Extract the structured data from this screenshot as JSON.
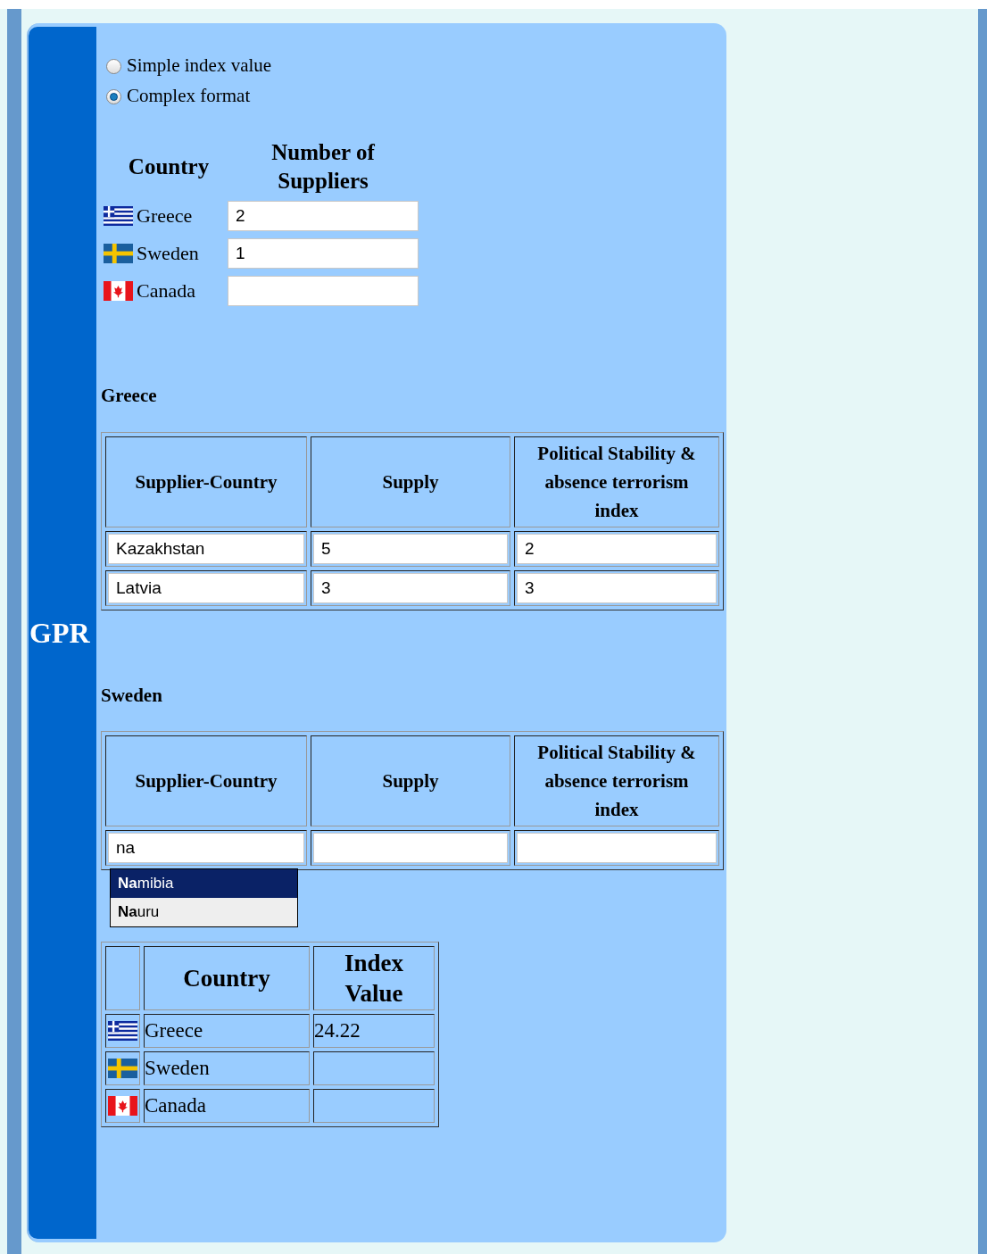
{
  "sidebar": {
    "label": "GPR"
  },
  "mode_options": [
    {
      "label": "Simple index value",
      "selected": false
    },
    {
      "label": "Complex format",
      "selected": true
    }
  ],
  "suppliers_table": {
    "columns": [
      "Country",
      "Number of Suppliers"
    ],
    "rows": [
      {
        "kind": "greece",
        "country": "Greece",
        "value": "2"
      },
      {
        "kind": "sweden",
        "country": "Sweden",
        "value": "1"
      },
      {
        "kind": "canada",
        "country": "Canada"
      }
    ]
  },
  "sections": [
    {
      "title": "Greece",
      "columns": [
        "Supplier-Country",
        "Supply",
        "Political Stability & absence terrorism index"
      ],
      "rows": [
        {
          "supplier": "Kazakhstan",
          "supply": "5",
          "index": "2"
        },
        {
          "supplier": "Latvia",
          "supply": "3",
          "index": "3"
        }
      ]
    },
    {
      "title": "Sweden",
      "columns": [
        "Supplier-Country",
        "Supply",
        "Political Stability & absence terrorism index"
      ],
      "rows": [
        {
          "supplier": "na"
        }
      ],
      "autocomplete": [
        {
          "label": "**Na**mibia",
          "selected": true
        },
        {
          "label": "**Na**uru",
          "selected": false
        }
      ]
    }
  ],
  "result_table": {
    "columns": [
      "Country",
      "Index Value"
    ],
    "rows": [
      {
        "kind": "greece",
        "country": "Greece",
        "value": "24.22"
      },
      {
        "kind": "sweden",
        "country": "Sweden"
      },
      {
        "kind": "canada",
        "country": "Canada"
      }
    ]
  }
}
